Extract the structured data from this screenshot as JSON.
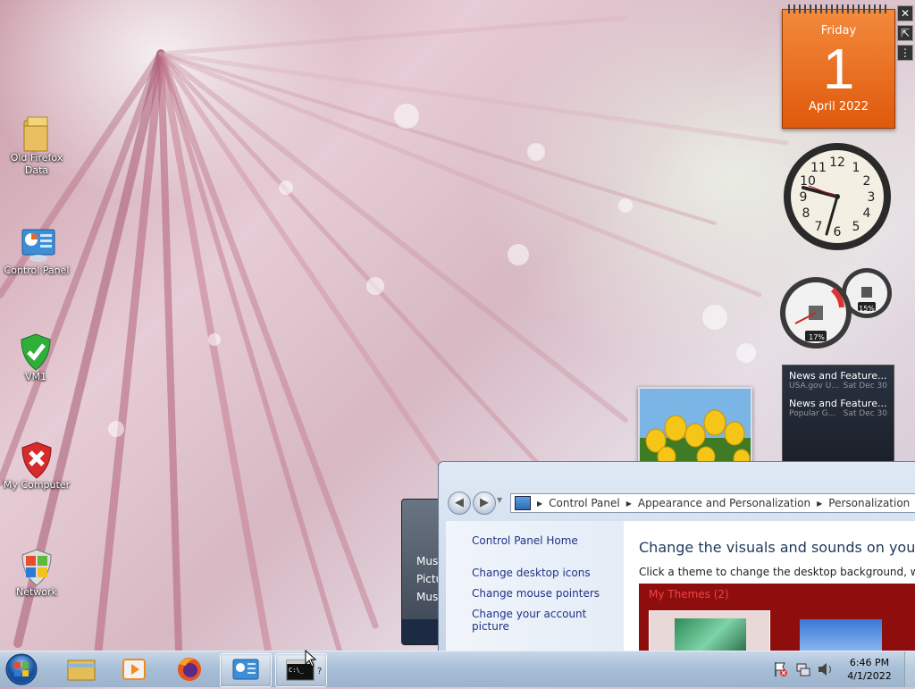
{
  "desktop": {
    "icons": [
      {
        "label": "Old Firefox Data",
        "icon": "folder-icon"
      },
      {
        "label": "Control Panel",
        "icon": "control-panel-icon"
      },
      {
        "label": "VM1",
        "icon": "green-shield-icon"
      },
      {
        "label": "My Computer",
        "icon": "red-shield-icon"
      },
      {
        "label": "Network",
        "icon": "windows-shield-icon"
      }
    ]
  },
  "gadgets": {
    "calendar": {
      "day_name": "Friday",
      "day_number": "1",
      "month_year": "April 2022",
      "color": "#e8651a"
    },
    "cpu_meter": {
      "cpu": "17%",
      "memory": "15%"
    },
    "feeds": [
      {
        "title": "News and Feature...",
        "source": "USA.gov U...",
        "date": "Sat Dec 30"
      },
      {
        "title": "News and Feature...",
        "source": "Popular G...",
        "date": "Sat Dec 30"
      }
    ]
  },
  "jump_list": {
    "items": [
      "Mus",
      "Pictu",
      "Mus"
    ]
  },
  "explorer": {
    "breadcrumb": [
      "Control Panel",
      "Appearance and Personalization",
      "Personalization"
    ],
    "left_links": {
      "home": "Control Panel Home",
      "links": [
        "Change desktop icons",
        "Change mouse pointers",
        "Change your account picture"
      ]
    },
    "heading": "Change the visuals and sounds on your com",
    "subtext": "Click a theme to change the desktop background, window",
    "themes_label": "My Themes (2)"
  },
  "taskbar": {
    "time": "6:46 PM",
    "date": "4/1/2022",
    "accent": "#aac0d8"
  }
}
